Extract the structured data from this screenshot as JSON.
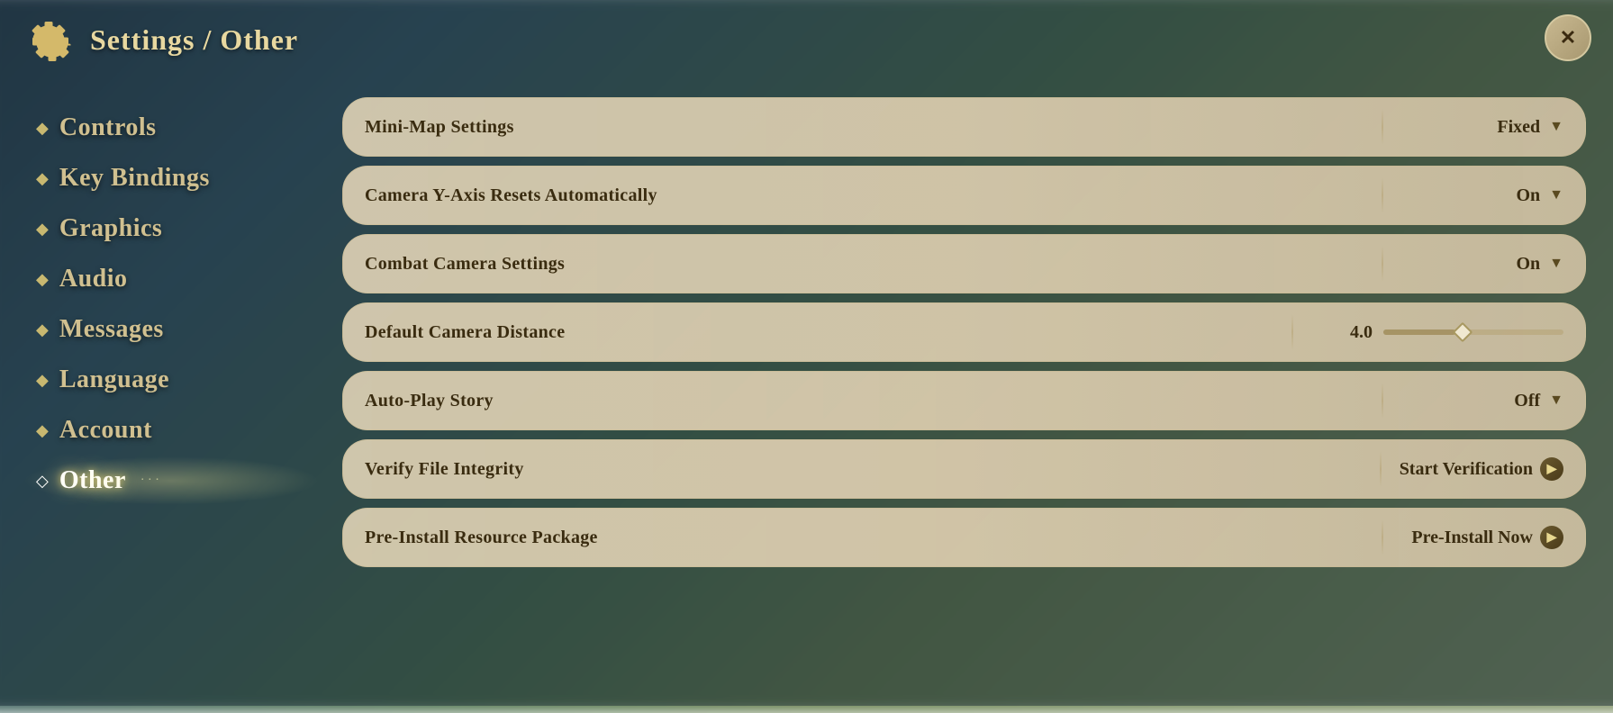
{
  "header": {
    "title": "Settings / Other",
    "close_label": "✕"
  },
  "sidebar": {
    "items": [
      {
        "id": "controls",
        "label": "Controls",
        "active": false
      },
      {
        "id": "key-bindings",
        "label": "Key Bindings",
        "active": false
      },
      {
        "id": "graphics",
        "label": "Graphics",
        "active": false
      },
      {
        "id": "audio",
        "label": "Audio",
        "active": false
      },
      {
        "id": "messages",
        "label": "Messages",
        "active": false
      },
      {
        "id": "language",
        "label": "Language",
        "active": false
      },
      {
        "id": "account",
        "label": "Account",
        "active": false
      },
      {
        "id": "other",
        "label": "Other",
        "active": true
      }
    ]
  },
  "settings": [
    {
      "id": "mini-map",
      "label": "Mini-Map Settings",
      "type": "dropdown",
      "value": "Fixed"
    },
    {
      "id": "camera-y-axis",
      "label": "Camera Y-Axis Resets Automatically",
      "type": "dropdown",
      "value": "On"
    },
    {
      "id": "combat-camera",
      "label": "Combat Camera Settings",
      "type": "dropdown",
      "value": "On"
    },
    {
      "id": "camera-distance",
      "label": "Default Camera Distance",
      "type": "slider",
      "value": "4.0",
      "slider_percent": 40
    },
    {
      "id": "auto-play",
      "label": "Auto-Play Story",
      "type": "dropdown",
      "value": "Off"
    },
    {
      "id": "verify",
      "label": "Verify File Integrity",
      "type": "action",
      "value": "Start Verification"
    },
    {
      "id": "pre-install",
      "label": "Pre-Install Resource Package",
      "type": "action",
      "value": "Pre-Install Now"
    }
  ]
}
